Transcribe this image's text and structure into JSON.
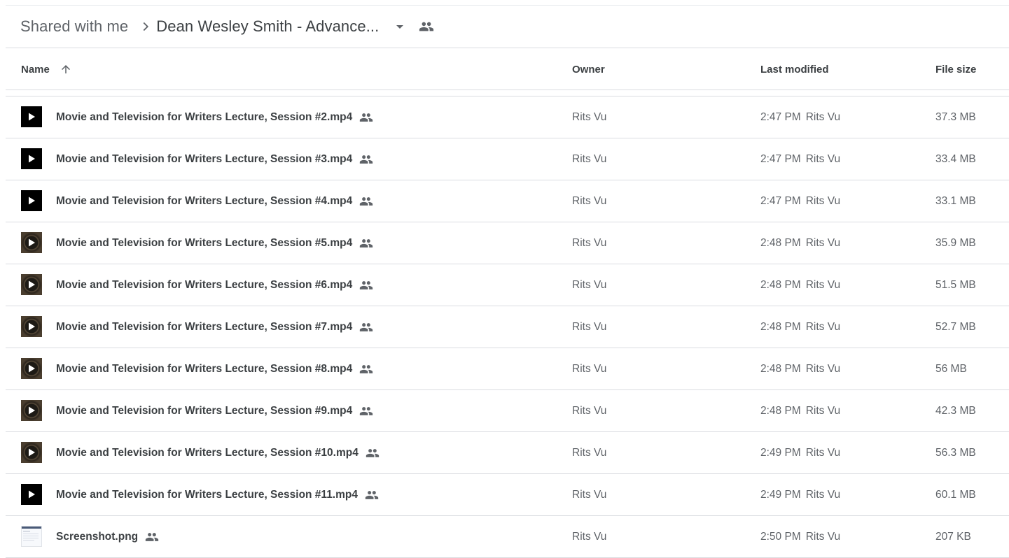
{
  "breadcrumb": {
    "root": "Shared with me",
    "current": "Dean Wesley Smith - Advance..."
  },
  "icons": {
    "separator": "chevron-right-icon",
    "dropdown": "caret-down-icon",
    "shared": "people-icon",
    "sort": "arrow-up-icon",
    "video": "play-icon"
  },
  "columns": {
    "name": "Name",
    "owner": "Owner",
    "modified": "Last modified",
    "size": "File size"
  },
  "files": [
    {
      "name": "Movie and Television for Writers Lecture, Session #2.mp4",
      "owner": "Rits Vu",
      "time": "2:47 PM",
      "by": "Rits Vu",
      "size": "37.3 MB",
      "thumb": "dark"
    },
    {
      "name": "Movie and Television for Writers Lecture, Session #3.mp4",
      "owner": "Rits Vu",
      "time": "2:47 PM",
      "by": "Rits Vu",
      "size": "33.4 MB",
      "thumb": "dark"
    },
    {
      "name": "Movie and Television for Writers Lecture, Session #4.mp4",
      "owner": "Rits Vu",
      "time": "2:47 PM",
      "by": "Rits Vu",
      "size": "33.1 MB",
      "thumb": "dark"
    },
    {
      "name": "Movie and Television for Writers Lecture, Session #5.mp4",
      "owner": "Rits Vu",
      "time": "2:48 PM",
      "by": "Rits Vu",
      "size": "35.9 MB",
      "thumb": "film"
    },
    {
      "name": "Movie and Television for Writers Lecture, Session #6.mp4",
      "owner": "Rits Vu",
      "time": "2:48 PM",
      "by": "Rits Vu",
      "size": "51.5 MB",
      "thumb": "film"
    },
    {
      "name": "Movie and Television for Writers Lecture, Session #7.mp4",
      "owner": "Rits Vu",
      "time": "2:48 PM",
      "by": "Rits Vu",
      "size": "52.7 MB",
      "thumb": "film"
    },
    {
      "name": "Movie and Television for Writers Lecture, Session #8.mp4",
      "owner": "Rits Vu",
      "time": "2:48 PM",
      "by": "Rits Vu",
      "size": "56 MB",
      "thumb": "film"
    },
    {
      "name": "Movie and Television for Writers Lecture, Session #9.mp4",
      "owner": "Rits Vu",
      "time": "2:48 PM",
      "by": "Rits Vu",
      "size": "42.3 MB",
      "thumb": "film"
    },
    {
      "name": "Movie and Television for Writers Lecture, Session #10.mp4",
      "owner": "Rits Vu",
      "time": "2:49 PM",
      "by": "Rits Vu",
      "size": "56.3 MB",
      "thumb": "film"
    },
    {
      "name": "Movie and Television for Writers Lecture, Session #11.mp4",
      "owner": "Rits Vu",
      "time": "2:49 PM",
      "by": "Rits Vu",
      "size": "60.1 MB",
      "thumb": "dark"
    },
    {
      "name": "Screenshot.png",
      "owner": "Rits Vu",
      "time": "2:50 PM",
      "by": "Rits Vu",
      "size": "207 KB",
      "thumb": "shot"
    }
  ]
}
